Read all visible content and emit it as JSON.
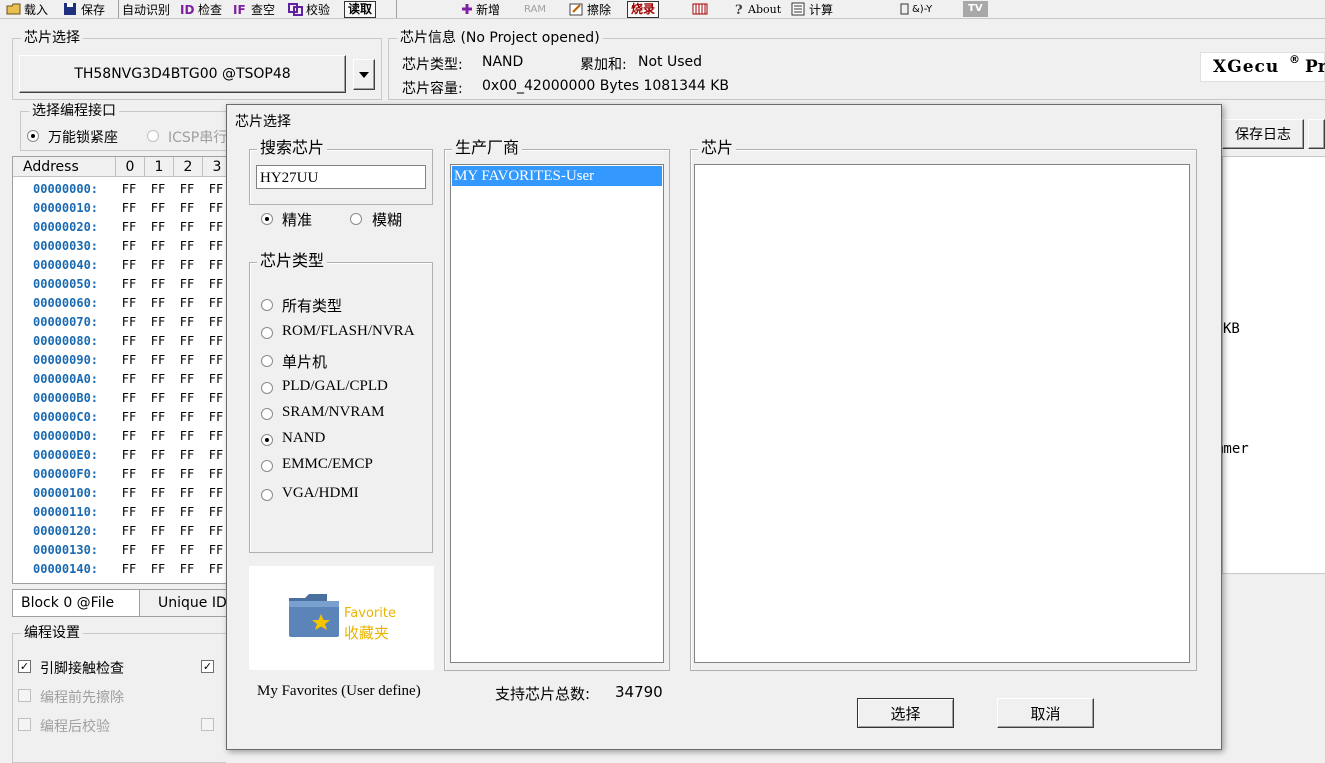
{
  "toolbar": {
    "load": "载入",
    "save": "保存",
    "auto_id": "自动识别",
    "check": "检查",
    "blank_check": "查空",
    "verify": "校验",
    "read": "读取",
    "add": "新增",
    "ram": "RAM",
    "erase": "擦除",
    "burn": "烧录",
    "about": "About",
    "calc": "计算",
    "logic": "&)-Y",
    "tv": "TV"
  },
  "chip_select": {
    "legend": "芯片选择",
    "current_chip": "TH58NVG3D4BTG00 @TSOP48"
  },
  "chip_info": {
    "legend": "芯片信息 (No Project opened)",
    "type_label": "芯片类型:",
    "type_value": "NAND",
    "sum_label": "累加和:",
    "sum_value": "Not Used",
    "capacity_label": "芯片容量:",
    "capacity_value": "0x00_42000000 Bytes 1081344 KB"
  },
  "brand": {
    "name": "XGecu",
    "reg": "®",
    "suffix": "Pr"
  },
  "interface": {
    "legend": "选择编程接口",
    "opt1": "万能锁紧座",
    "opt2": "ICSP串行"
  },
  "right_panel": {
    "save_log": "保存日志",
    "fragment_kb": "KB",
    "fragment_mmer": "mmer"
  },
  "hex": {
    "headers": [
      "Address",
      "0",
      "1",
      "2",
      "3"
    ],
    "rows": [
      "00000000:",
      "00000010:",
      "00000020:",
      "00000030:",
      "00000040:",
      "00000050:",
      "00000060:",
      "00000070:",
      "00000080:",
      "00000090:",
      "000000A0:",
      "000000B0:",
      "000000C0:",
      "000000D0:",
      "000000E0:",
      "000000F0:",
      "00000100:",
      "00000110:",
      "00000120:",
      "00000130:",
      "00000140:"
    ],
    "cell": "FF"
  },
  "tabs": {
    "block": "Block 0 @File",
    "unique": "Unique ID"
  },
  "prog_settings": {
    "legend": "编程设置",
    "pin_check": "引脚接触检查",
    "erase_before": "编程前先擦除",
    "verify_after": "编程后校验"
  },
  "dialog": {
    "title": "芯片选择",
    "search_legend": "搜索芯片",
    "search_value": "HY27UU",
    "exact": "精准",
    "fuzzy": "模糊",
    "type_legend": "芯片类型",
    "types": [
      "所有类型",
      "ROM/FLASH/NVRA",
      "单片机",
      "PLD/GAL/CPLD",
      "SRAM/NVRAM",
      "NAND",
      "EMMC/EMCP",
      "VGA/HDMI"
    ],
    "selected_type": "NAND",
    "favorite_en": "Favorite",
    "favorite_cn": "收藏夹",
    "favorites_caption": "My Favorites (User define)",
    "vendor_legend": "生产厂商",
    "vendors": [
      "MY FAVORITES-User"
    ],
    "chip_legend": "芯片",
    "total_label": "支持芯片总数:",
    "total_value": "34790",
    "ok": "选择",
    "cancel": "取消"
  },
  "colors": {
    "selection": "#3399ff",
    "hex_address": "#1a6ab3",
    "favorite_text": "#e8b400",
    "folder": "#5b84b8"
  }
}
